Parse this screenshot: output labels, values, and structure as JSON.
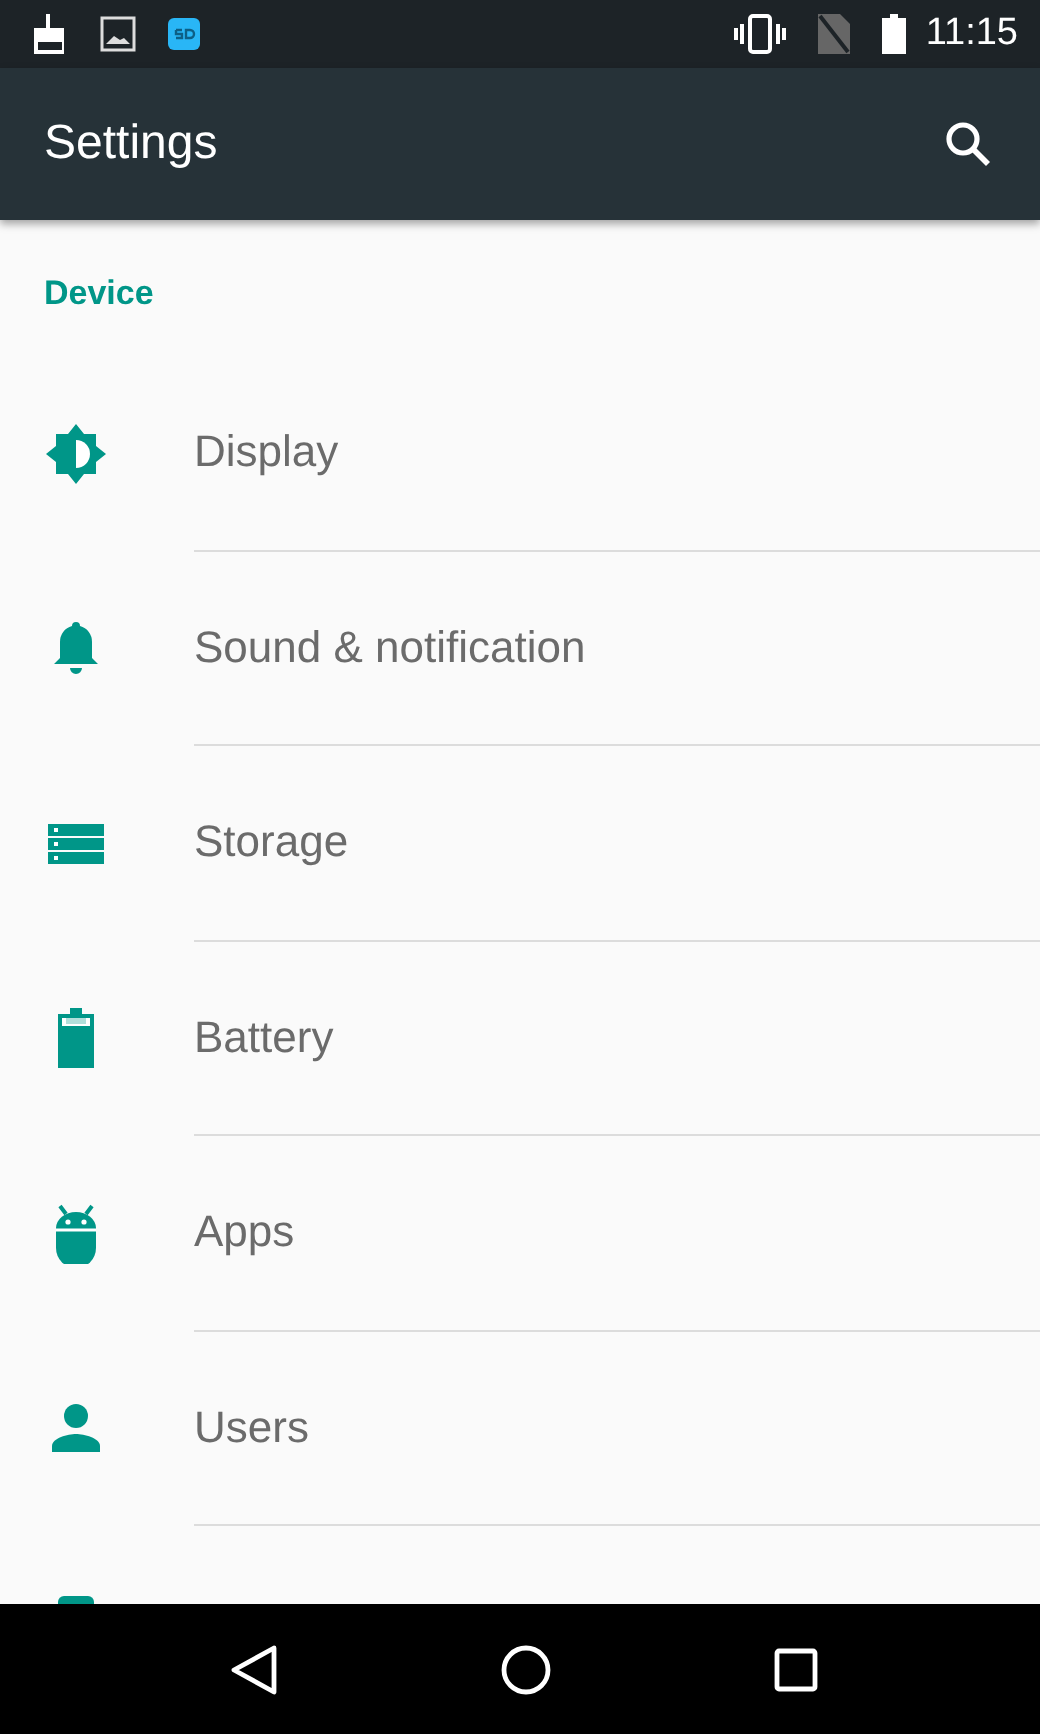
{
  "status_bar": {
    "notification_icons": [
      {
        "kind": "broom"
      },
      {
        "kind": "image"
      },
      {
        "kind": "sd"
      }
    ],
    "system_icons": [
      {
        "kind": "vibrate"
      },
      {
        "kind": "no-sim"
      },
      {
        "kind": "battery"
      }
    ],
    "time": "11:15"
  },
  "app_bar": {
    "title": "Settings"
  },
  "section": {
    "title": "Device"
  },
  "items": [
    {
      "kind": "display",
      "label": "Display"
    },
    {
      "kind": "sound",
      "label": "Sound & notification"
    },
    {
      "kind": "storage",
      "label": "Storage"
    },
    {
      "kind": "battery",
      "label": "Battery"
    },
    {
      "kind": "apps",
      "label": "Apps"
    },
    {
      "kind": "users",
      "label": "Users"
    },
    {
      "kind": "cut"
    }
  ],
  "nav_bar": {
    "buttons": [
      {
        "kind": "back"
      },
      {
        "kind": "home"
      },
      {
        "kind": "recents"
      }
    ]
  }
}
